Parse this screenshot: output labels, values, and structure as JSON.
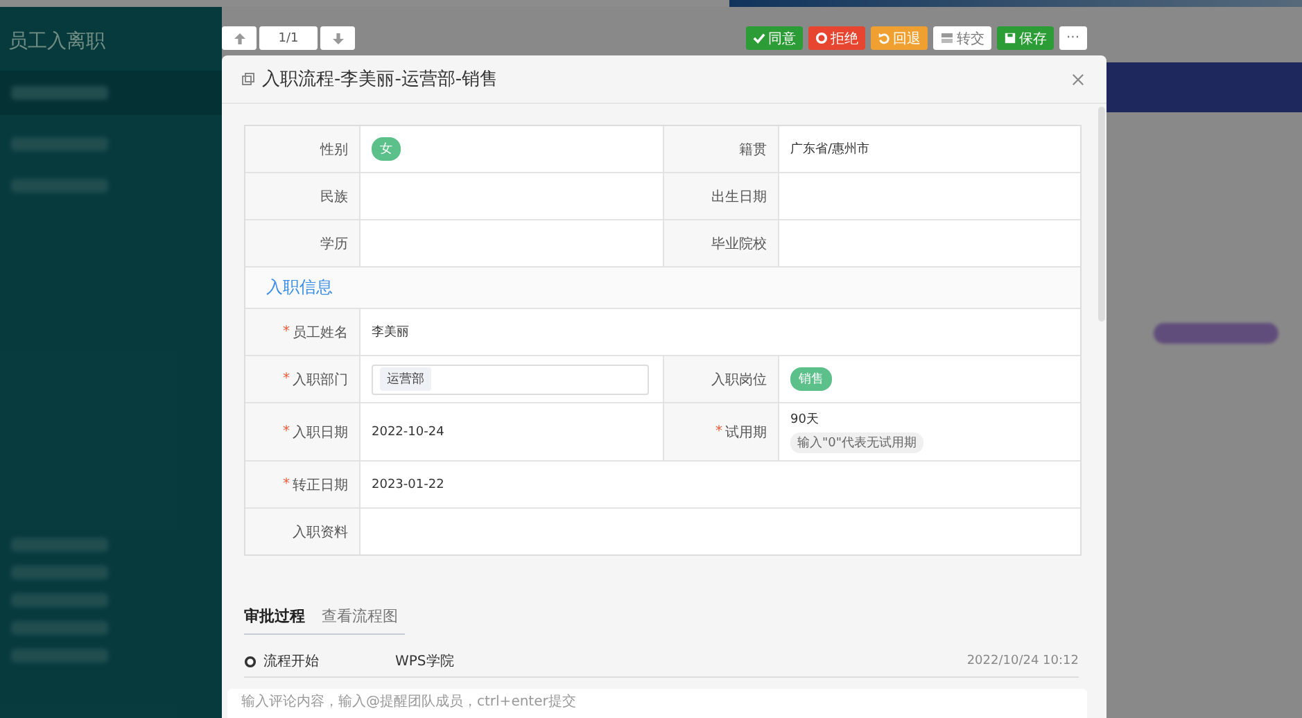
{
  "app": {
    "title": "员工入离职"
  },
  "pager": {
    "counter": "1/1"
  },
  "actions": [
    {
      "label": "同意",
      "kind": "agree"
    },
    {
      "label": "拒绝",
      "kind": "reject"
    },
    {
      "label": "回退",
      "kind": "back"
    },
    {
      "label": "转交",
      "kind": "transfer"
    },
    {
      "label": "保存",
      "kind": "save"
    },
    {
      "label": "···",
      "kind": "more"
    }
  ],
  "dialog": {
    "title": "入职流程-李美丽-运营部-销售",
    "rows": [
      {
        "kind": "pair",
        "cells": [
          {
            "label": "性别",
            "kind": "tag",
            "value": "女"
          },
          {
            "label": "籍贯",
            "kind": "text",
            "value": "广东省/惠州市"
          }
        ]
      },
      {
        "kind": "pair",
        "cells": [
          {
            "label": "民族",
            "kind": "text"
          },
          {
            "label": "出生日期",
            "kind": "text"
          }
        ]
      },
      {
        "kind": "pair",
        "cells": [
          {
            "label": "学历",
            "kind": "text"
          },
          {
            "label": "毕业院校",
            "kind": "text"
          }
        ]
      },
      {
        "kind": "section",
        "title": "入职信息"
      },
      {
        "kind": "single",
        "cells": [
          {
            "label": "员工姓名",
            "mark": "*",
            "kind": "text",
            "value": "李美丽"
          }
        ]
      },
      {
        "kind": "pair",
        "cells": [
          {
            "label": "入职部门",
            "mark": "*",
            "kind": "select",
            "value": "运营部"
          },
          {
            "label": "入职岗位",
            "kind": "tag",
            "value": "销售"
          }
        ]
      },
      {
        "kind": "pair",
        "cells": [
          {
            "label": "入职日期",
            "mark": "*",
            "kind": "text",
            "value": "2022-10-24"
          },
          {
            "label": "试用期",
            "mark": "*",
            "kind": "text",
            "value": "90天",
            "hint": "输入\"0\"代表无试用期"
          }
        ]
      },
      {
        "kind": "single",
        "cells": [
          {
            "label": "转正日期",
            "mark": "*",
            "kind": "text",
            "value": "2023-01-22"
          }
        ]
      },
      {
        "kind": "single",
        "cells": [
          {
            "label": "入职资料",
            "kind": "text"
          }
        ]
      }
    ],
    "tabs": [
      {
        "label": "审批过程",
        "selected": true
      },
      {
        "label": "查看流程图",
        "selected": false
      }
    ],
    "timeline": [
      {
        "step": "流程开始",
        "actor": "WPS学院",
        "time": "2022/10/24 10:12"
      }
    ],
    "comment": {
      "placeholder": "输入评论内容，输入@提醒团队成员，ctrl+enter提交"
    }
  }
}
